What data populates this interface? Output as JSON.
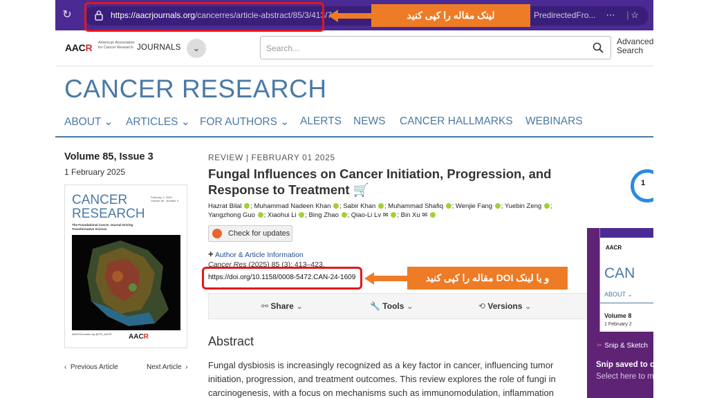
{
  "browser": {
    "url_host": "https://aacrjournals.org",
    "url_path": "/cancerres/article-abstract/85/3/413/7...",
    "url_tail": "PredirectedFro..."
  },
  "annotations": {
    "link_callout": "لینک مقاله را کپی کنید",
    "doi_callout": "و یا لینک DOI مقاله را کپی کنید"
  },
  "header": {
    "logo": "AAC",
    "logo_r": "R",
    "logo_sub": "American Association for Cancer Research",
    "journals": "JOURNALS",
    "search_placeholder": "Search...",
    "advanced_search": "Advanced Search"
  },
  "journal_title": "CANCER RESEARCH",
  "nav": {
    "about": "ABOUT ⌄",
    "articles": "ARTICLES ⌄",
    "for_authors": "FOR AUTHORS ⌄",
    "alerts": "ALERTS",
    "news": "NEWS",
    "hallmarks": "CANCER HALLMARKS",
    "webinars": "WEBINARS"
  },
  "issue": {
    "volume": "Volume 85, Issue 3",
    "date": "1 February 2025",
    "cover_title": "CANCER RESEARCH",
    "cover_subtitle": "The Foundational Cancer Journal Driving Transformative Science",
    "cover_meta": "February 1, 2025 · Volume 85 · Number 3",
    "cover_footer": "AACRJournals.org @CR_AACR",
    "previous": "Previous Article",
    "next": "Next Article"
  },
  "article": {
    "category": "REVIEW |  FEBRUARY 01 2025",
    "title": "Fungal Influences on Cancer Initiation, Progression, and Response to Treatment",
    "authors": [
      "Hazrat Bilal",
      "Muhammad Nadeen Khan",
      "Sabir Khan",
      "Muhammad Shafiq",
      "Wenjie Fang",
      "Yuebin Zeng",
      "Yangzhong Guo",
      "Xiaohui Li",
      "Bing Zhao",
      "Qiao-Li Lv",
      "Bin Xu"
    ],
    "check_updates": "Check for updates",
    "author_info": "Author & Article Information",
    "citation_journal": "Cancer Res",
    "citation_rest": " (2025) 85 (3): 413–423.",
    "doi": "https://doi.org/10.1158/0008-5472.CAN-24-1609",
    "share": "Share",
    "tools": "Tools",
    "versions": "Versions",
    "metric_count": "1",
    "abstract_heading": "Abstract",
    "abstract_text": "Fungal dysbiosis is increasingly recognized as a key factor in cancer, influencing tumor initiation, progression, and treatment outcomes. This review explores the role of fungi in carcinogenesis, with a focus on mechanisms such as immunomodulation, inflammation"
  },
  "snip": {
    "app": "Snip & Sketch",
    "saved": "Snip saved to c",
    "select": "Select here to m",
    "thumb_logo": "AACR",
    "thumb_title": "CAN",
    "thumb_about": "ABOUT ⌄",
    "thumb_vol": "Volume 8",
    "thumb_date": "1 February 2"
  },
  "colors": {
    "brand_blue": "#4a79a5",
    "browser_purple": "#4b2a93",
    "highlight_red": "#e3161c",
    "callout_orange": "#ee7b25",
    "orcid_green": "#a6ce39",
    "snip_purple": "#5e2375"
  }
}
